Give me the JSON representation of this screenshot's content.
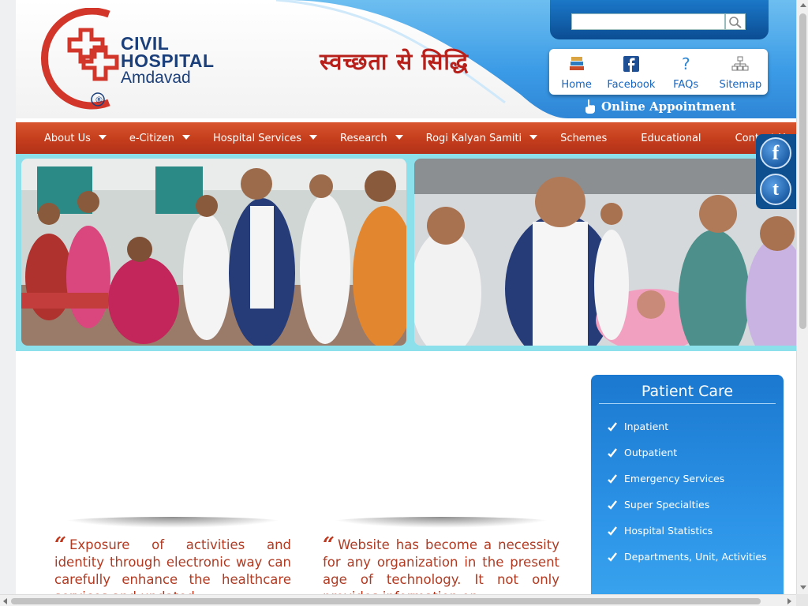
{
  "header": {
    "logo": {
      "line1": "CIVIL",
      "line2": "HOSPITAL",
      "line3": "Amdavad",
      "mark": "®"
    },
    "tagline": "स्वच्छता से सिद्धि",
    "search": {
      "placeholder": "",
      "value": "",
      "icon": "search-icon"
    },
    "quick_links": [
      {
        "label": "Home",
        "icon": "home-books-icon"
      },
      {
        "label": "Facebook",
        "icon": "facebook-icon"
      },
      {
        "label": "FAQs",
        "icon": "question-icon"
      },
      {
        "label": "Sitemap",
        "icon": "sitemap-icon"
      }
    ],
    "online_appointment": "Online Appointment"
  },
  "nav": {
    "items": [
      {
        "label": "About Us",
        "has_dropdown": true
      },
      {
        "label": "e-Citizen",
        "has_dropdown": true
      },
      {
        "label": "Hospital Services",
        "has_dropdown": true
      },
      {
        "label": "Research",
        "has_dropdown": true
      },
      {
        "label": "Rogi Kalyan Samiti",
        "has_dropdown": true
      },
      {
        "label": "Schemes",
        "has_dropdown": false
      },
      {
        "label": "Educational",
        "has_dropdown": false
      },
      {
        "label": "Contact Us",
        "has_dropdown": false
      }
    ]
  },
  "social": [
    {
      "label": "f",
      "icon": "facebook-icon"
    },
    {
      "label": "t",
      "icon": "twitter-icon"
    }
  ],
  "quotes": {
    "left": "Exposure of activities and identity through electronic way can carefully enhance the healthcare services and updated",
    "right": "Website has become a necessity for any organization in the present age of technology. It not only provides information on"
  },
  "patient_care": {
    "title": "Patient Care",
    "items": [
      "Inpatient",
      "Outpatient",
      "Emergency Services",
      "Super Specialties",
      "Hospital Statistics",
      "Departments, Unit, Activities"
    ]
  },
  "colors": {
    "nav_bg": "#c43d1c",
    "brand_blue": "#1b3f7a",
    "brand_red": "#d2362a",
    "accent_blue": "#1b79cf",
    "banner_bg": "#8ce0ec",
    "quote_text": "#b03a22"
  }
}
